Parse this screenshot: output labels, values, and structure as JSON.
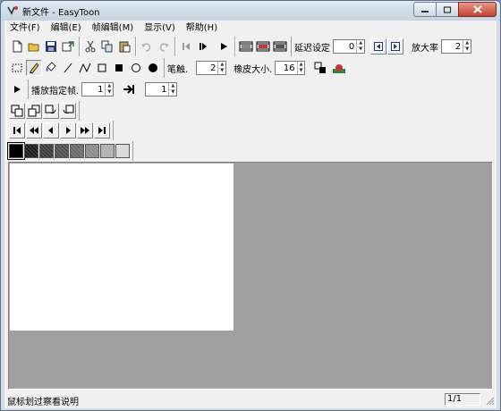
{
  "window": {
    "title": "新文件 - EasyToon"
  },
  "menu": [
    "文件(F)",
    "编辑(E)",
    "帧编辑(M)",
    "显示(V)",
    "帮助(H)"
  ],
  "toolbar1": {
    "delay_label": "延迟设定",
    "delay_value": "0",
    "zoom_label": "放大率",
    "zoom_value": "2"
  },
  "toolbar2": {
    "pen_label": "笔触.",
    "pen_value": "2",
    "eraser_label": "橡皮大小.",
    "eraser_value": "16"
  },
  "toolbar3": {
    "play_frame_label": "播放指定帧.",
    "from_value": "1",
    "to_value": "1"
  },
  "palette": {
    "swatches": [
      "#000000",
      "#1a1a1a",
      "#3a3a3a",
      "#4e4e4e",
      "#6a6a6a",
      "#8a8a8a",
      "#b0b0b0",
      "#d8d8d8"
    ]
  },
  "statusbar": {
    "message": "鼠标划过察看说明",
    "frame_counter": "1/1"
  }
}
